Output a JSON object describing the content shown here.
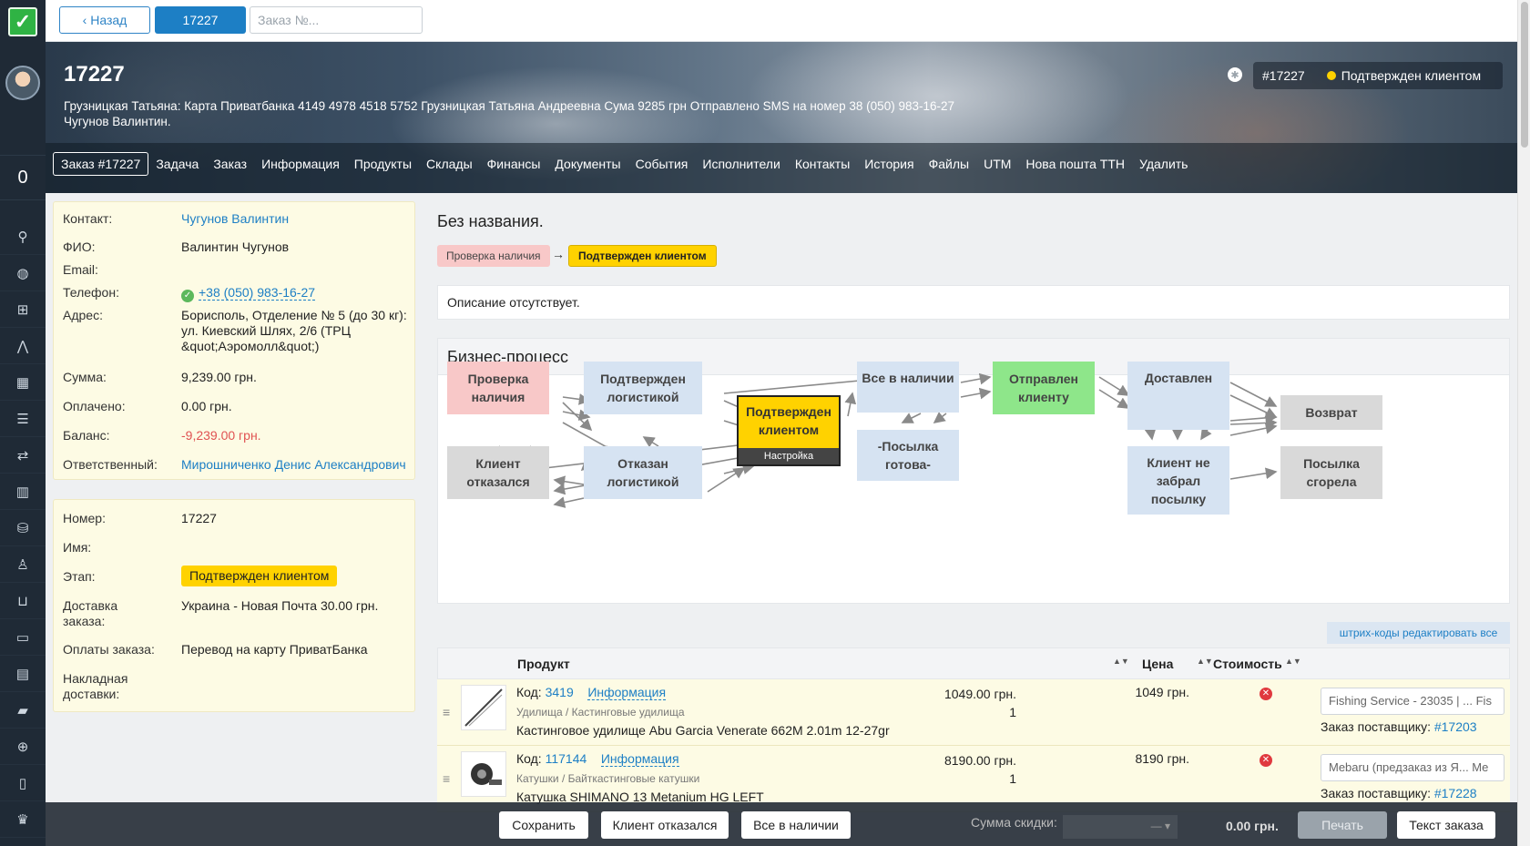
{
  "topbar": {
    "back_label": "‹ Назад",
    "order_number": "17227",
    "search_placeholder": "Заказ №..."
  },
  "rail": {
    "counter": "0",
    "icons": [
      "search-icon",
      "globe-icon",
      "plus-box-icon",
      "share-icon",
      "calendar-icon",
      "table-icon",
      "transfer-icon",
      "barcode-icon",
      "database-icon",
      "user-settings-icon",
      "box-icon",
      "wallet-icon",
      "cash-register-icon",
      "chat-icon",
      "clipboard-add-icon",
      "document-icon",
      "crown-icon"
    ]
  },
  "header": {
    "title": "17227",
    "subtitle": "Грузницкая Татьяна: Карта Приватбанка 4149 4978 4518 5752 Грузницкая Татьяна Андреевна Сума 9285 грн Отправлено SMS на номер 38 (050) 983-16-27",
    "subtitle2": "Чугунов Валинтин.",
    "order_tag": "#17227",
    "status": "Подтвержден клиентом",
    "status_color": "#ffd200"
  },
  "tabs": [
    "Заказ #17227",
    "Задача",
    "Заказ",
    "Информация",
    "Продукты",
    "Склады",
    "Финансы",
    "Документы",
    "События",
    "Исполнители",
    "Контакты",
    "История",
    "Файлы",
    "UTM",
    "Нова пошта ТТН",
    "Удалить"
  ],
  "contact_panel": {
    "contact_label": "Контакт:",
    "contact_value": "Чугунов Валинтин",
    "fio_label": "ФИО:",
    "fio_value": "Валинтин Чугунов",
    "email_label": "Email:",
    "phone_label": "Телефон:",
    "phone_value": "+38 (050) 983-16-27",
    "address_label": "Адрес:",
    "address_value": "Борисполь, Отделение № 5 (до 30 кг): ул. Киевский Шлях, 2/6 (ТРЦ &quot;Аэромолл&quot;)",
    "sum_label": "Сумма:",
    "sum_value": "9,239.00 грн.",
    "paid_label": "Оплачено:",
    "paid_value": "0.00 грн.",
    "balance_label": "Баланс:",
    "balance_value": "-9,239.00 грн.",
    "resp_label": "Ответственный:",
    "resp_value": "Мирошниченко Денис Александрович"
  },
  "order_panel": {
    "number_label": "Номер:",
    "number_value": "17227",
    "name_label": "Имя:",
    "stage_label": "Этап:",
    "stage_value": "Подтвержден клиентом",
    "delivery_label": "Доставка заказа:",
    "delivery_value": "Украина - Новая Почта 30.00 грн.",
    "payment_label": "Оплаты заказа:",
    "payment_value": "Перевод на карту ПриватБанка",
    "waybill_label": "Накладная доставки:"
  },
  "main": {
    "title": "Без названия.",
    "prev_stage": "Проверка наличия",
    "arrow": "→",
    "current_stage": "Подтвержден клиентом",
    "description": "Описание отсутствует."
  },
  "business_process": {
    "title": "Бизнес-процесс",
    "nodes": {
      "check": "Проверка наличия",
      "conf_log": "Подтвержден логистикой",
      "conf_client": "Подтвержден клиентом",
      "settings": "Настройка",
      "all_stock": "Все в наличии",
      "parcel_ready": "-Посылка готова-",
      "sent": "Отправлен клиенту",
      "delivered": "Доставлен",
      "refused": "Клиент отказался",
      "denied_log": "Отказан логистикой",
      "not_picked": "Клиент не забрал посылку",
      "returned": "Возврат",
      "burned": "Посылка сгорела"
    }
  },
  "products": {
    "barcodes_btn": "штрих-коды редактировать все",
    "col_product": "Продукт",
    "col_price": "Цена",
    "col_cost": "Стоимость",
    "rows": [
      {
        "code_label": "Код:",
        "code": "3419",
        "info": "Информация",
        "category": "Удилища / Кастинговые удилища",
        "name": "Кастинговое удилище Abu Garcia Venerate 662M 2.01m 12-27gr",
        "price": "1049.00 грн.",
        "qty": "1",
        "cost": "1049 грн.",
        "supplier": "Fishing Service - 23035 | ...  Fis",
        "supplier_order_label": "Заказ поставщику:",
        "supplier_order": "#17203"
      },
      {
        "code_label": "Код:",
        "code": "117144",
        "info": "Информация",
        "category": "Катушки / Байткастинговые катушки",
        "name": "Катушка SHIMANO 13 Metanium HG LEFT",
        "price": "8190.00 грн.",
        "qty": "1",
        "cost": "8190 грн.",
        "supplier": "Mebaru (предзаказ из Я...  Me",
        "supplier_order_label": "Заказ поставщику:",
        "supplier_order": "#17228"
      }
    ]
  },
  "bottombar": {
    "save": "Сохранить",
    "refused": "Клиент отказался",
    "all_stock": "Все в наличии",
    "discount_label": "Сумма скидки:",
    "discount_value": "— ▾",
    "total": "0.00 грн.",
    "print": "Печать",
    "order_text": "Текст заказа"
  }
}
